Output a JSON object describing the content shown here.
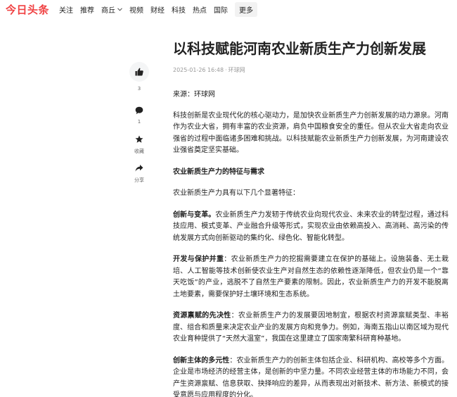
{
  "nav": {
    "logo": "今日头条",
    "items": [
      "关注",
      "推荐",
      "商丘",
      "视频",
      "财经",
      "科技",
      "热点",
      "国际"
    ],
    "more": "更多"
  },
  "article": {
    "title": "以科技赋能河南农业新质生产力创新发展",
    "datetime": "2025-01-26 16:48",
    "separator": "·",
    "publisher": "环球网",
    "source": "来源：环球网",
    "paragraphs": {
      "p1": "科技创新是农业现代化的核心驱动力，是加快农业新质生产力创新发展的动力源泉。河南作为农业大省，拥有丰富的农业资源，肩负中国粮食安全的重任。但从农业大省走向农业强省的过程中面临诸多困难和挑战。以科技赋能农业新质生产力创新发展，为河南建设农业强省奠定坚实基础。",
      "heading1": "农业新质生产力的特征与需求",
      "p2": "农业新质生产力具有以下几个显著特征：",
      "p3_bold": "创新与变革。",
      "p3": "农业新质生产力发轫于传统农业向现代农业、未来农业的转型过程，通过科技应用、模式变革、产业融合升级等形式，实现农业由依赖高投入、高消耗、高污染的传统发展方式向创新驱动的集约化、绿色化、智能化转型。",
      "p4_bold": "开发与保护并重",
      "p4": "：农业新质生产力的挖掘需要建立在保护的基础上。设施装备、无土栽培、人工智能等技术创新使农业生产对自然生态的依赖性逐渐降低，但农业仍是一个“靠天吃饭”的产业，逃脱不了自然生产要素的限制。因此，农业新质生产力的开发不能脱离土地要素，需要保护好土壤环境和生态系统。",
      "p5_bold": "资源禀赋的先决性",
      "p5": "：农业新质生产力的发展要因地制宜，根据农村资源禀赋类型、丰裕度、组合和质量来决定农业产业的发展方向和竞争力。例如，海南五指山以南区域为现代农业育种提供了“天然大温室”，我国在这里建立了国家南繁科研育种基地。",
      "p6_bold": "创新主体的多元性",
      "p6": "：农业新质生产力的创新主体包括企业、科研机构、高校等多个方面。企业是市场经济的经营主体，是创新的中坚力量。不同农业经营主体的市场能力不同，会产生资源禀赋、信息获取、抉择响应的差异，从而表现出对新技术、新方法、新模式的接受意愿与应用程度的分化。"
    }
  },
  "sidebar": {
    "like_count": "3",
    "comment_count": "1",
    "favorite_label": "收藏",
    "share_label": "分享"
  },
  "colors": {
    "brand_red": "#f04142",
    "text": "#222222",
    "meta_gray": "#999999"
  }
}
